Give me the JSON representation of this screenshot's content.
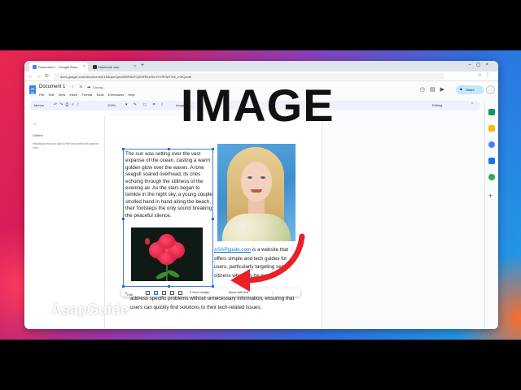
{
  "overlay": {
    "title": "IMAGE"
  },
  "brand": {
    "name": "AsapGuide"
  },
  "browser": {
    "tabs": [
      {
        "label": "Document 1 - Google Docs",
        "active": true
      },
      {
        "label": "Notebook vids",
        "active": false
      }
    ],
    "url": "docs.google.com/document/d/1K8dpnCjeuWWFBDFQD9FBxe2hc7hYRFMTIHlt_zYeQ/edit"
  },
  "docs": {
    "title": "Document 1",
    "save_status": "Saving...",
    "menus": [
      "File",
      "Edit",
      "View",
      "Insert",
      "Format",
      "Tools",
      "Extensions",
      "Help"
    ],
    "share_label": "Share",
    "toolbar": {
      "menus_label": "Menus",
      "zoom": "100%",
      "image_options": "Image opt...",
      "mode": "Editing"
    }
  },
  "outline": {
    "title": "Outline",
    "hint": "Headings that you add to the document will appear here."
  },
  "document": {
    "story": "The sun was setting over the vast expanse of the ocean, casting a warm golden glow over the waves. A lone seagull soared overhead, its cries echoing through the stillness of the evening air. As the stars began to twinkle in the night sky, a young couple strolled hand in hand along the beach, their footsteps the only sound breaking the peaceful silence.",
    "link_text": "ASAPguide.com",
    "side_text": " is a website that offers simple and tech guides for users, particularly targeting senior citizens who may be less",
    "body_text": "address specific problems without unnecessary information, ensuring that users can quickly find solutions to their tech-related issues."
  },
  "image_toolbar": {
    "edit_label": "Edit",
    "margin_label": "3.2mm margin",
    "position_label": "Move with text"
  },
  "colors": {
    "accent": "#1a73e8",
    "share_bg": "#c2e7ff",
    "selection": "#4a7dd6",
    "arrow": "#e8202a"
  },
  "icons": [
    "back-arrow-icon",
    "star-icon",
    "move-icon",
    "cloud-icon",
    "history-icon",
    "comment-icon",
    "video-icon",
    "lock-icon",
    "up-chevron-icon"
  ]
}
